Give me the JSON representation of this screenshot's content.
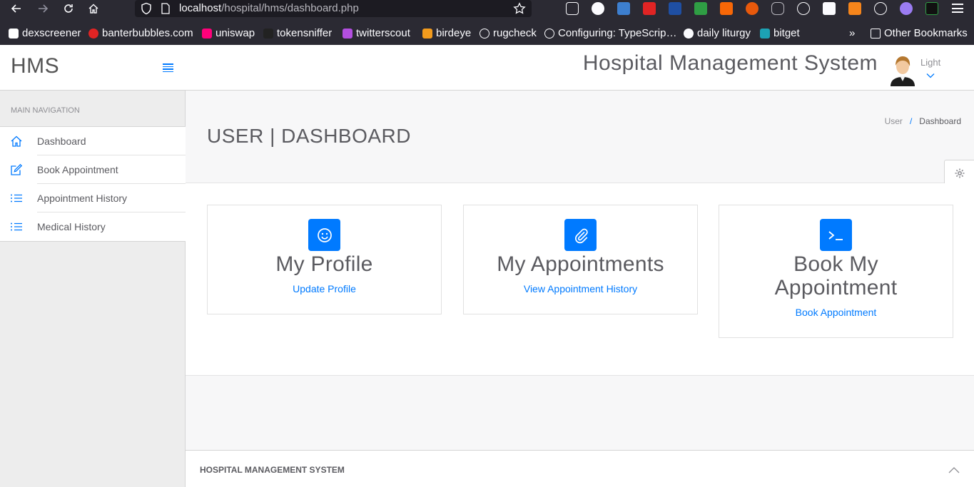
{
  "browser": {
    "url_host": "localhost",
    "url_path": "/hospital/hms/dashboard.php",
    "bookmarks": [
      {
        "label": "dexscreener",
        "color": "#ffffff"
      },
      {
        "label": "banterbubbles.com",
        "color": "#e02424"
      },
      {
        "label": "uniswap",
        "color": "#ff007a"
      },
      {
        "label": "tokensniffer",
        "color": "#222222"
      },
      {
        "label": "twitterscout",
        "color": "#b34fe0"
      },
      {
        "label": "birdeye",
        "color": "#f29b1d"
      },
      {
        "label": "rugcheck",
        "color": "#fbfbfe"
      },
      {
        "label": "Configuring: TypeScrip…",
        "color": "#fbfbfe"
      },
      {
        "label": "daily liturgy",
        "color": "#fbfbfe"
      },
      {
        "label": "bitget",
        "color": "#1da2b4"
      }
    ],
    "other_bookmarks": "Other Bookmarks"
  },
  "sidebar": {
    "brand": "HMS",
    "nav_heading": "MAIN NAVIGATION",
    "items": [
      {
        "label": "Dashboard",
        "icon": "home-icon"
      },
      {
        "label": "Book Appointment",
        "icon": "edit-icon"
      },
      {
        "label": "Appointment History",
        "icon": "list-icon"
      },
      {
        "label": "Medical History",
        "icon": "list-icon"
      }
    ]
  },
  "topbar": {
    "title": "Hospital Management System",
    "user": "Light"
  },
  "page": {
    "title": "USER | DASHBOARD",
    "breadcrumb": [
      "User",
      "Dashboard"
    ]
  },
  "cards": [
    {
      "title": "My Profile",
      "link": "Update Profile",
      "icon": "smile-icon"
    },
    {
      "title": "My Appointments",
      "link": "View Appointment History",
      "icon": "paperclip-icon"
    },
    {
      "title": "Book My Appointment",
      "link": "Book Appointment",
      "icon": "terminal-icon"
    }
  ],
  "footer": {
    "text": "HOSPITAL MANAGEMENT SYSTEM"
  },
  "colors": {
    "accent": "#007aff",
    "browser_bg": "#2b2a33"
  }
}
